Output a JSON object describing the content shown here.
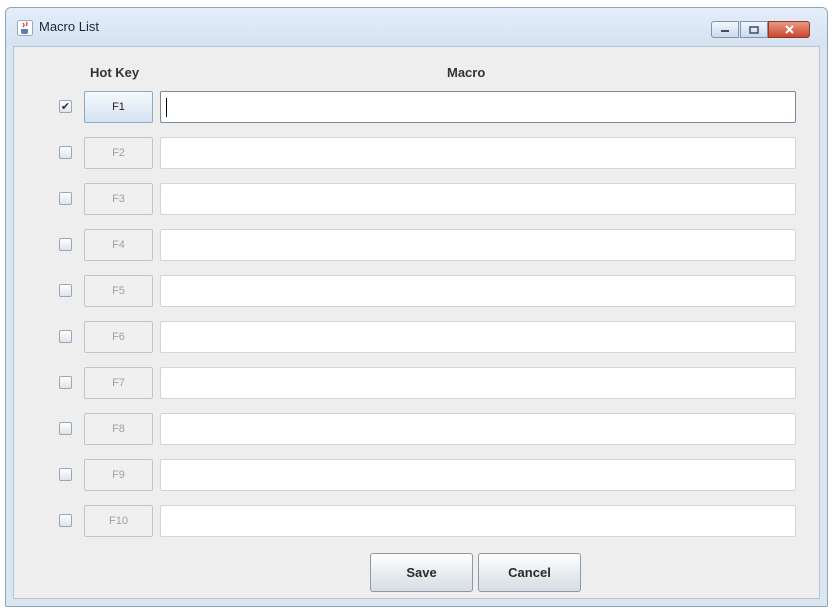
{
  "window": {
    "title": "Macro List"
  },
  "headers": {
    "hotkey": "Hot Key",
    "macro": "Macro"
  },
  "rows": [
    {
      "key": "F1",
      "checked": true,
      "macro": ""
    },
    {
      "key": "F2",
      "checked": false,
      "macro": ""
    },
    {
      "key": "F3",
      "checked": false,
      "macro": ""
    },
    {
      "key": "F4",
      "checked": false,
      "macro": ""
    },
    {
      "key": "F5",
      "checked": false,
      "macro": ""
    },
    {
      "key": "F6",
      "checked": false,
      "macro": ""
    },
    {
      "key": "F7",
      "checked": false,
      "macro": ""
    },
    {
      "key": "F8",
      "checked": false,
      "macro": ""
    },
    {
      "key": "F9",
      "checked": false,
      "macro": ""
    },
    {
      "key": "F10",
      "checked": false,
      "macro": ""
    }
  ],
  "buttons": {
    "save": "Save",
    "cancel": "Cancel"
  },
  "icons": {
    "app": "java-cup-icon",
    "minimize": "minimize-icon",
    "maximize": "maximize-icon",
    "close": "close-icon"
  },
  "colors": {
    "close_button": "#c9462c",
    "frame": "#dbe6f3"
  }
}
